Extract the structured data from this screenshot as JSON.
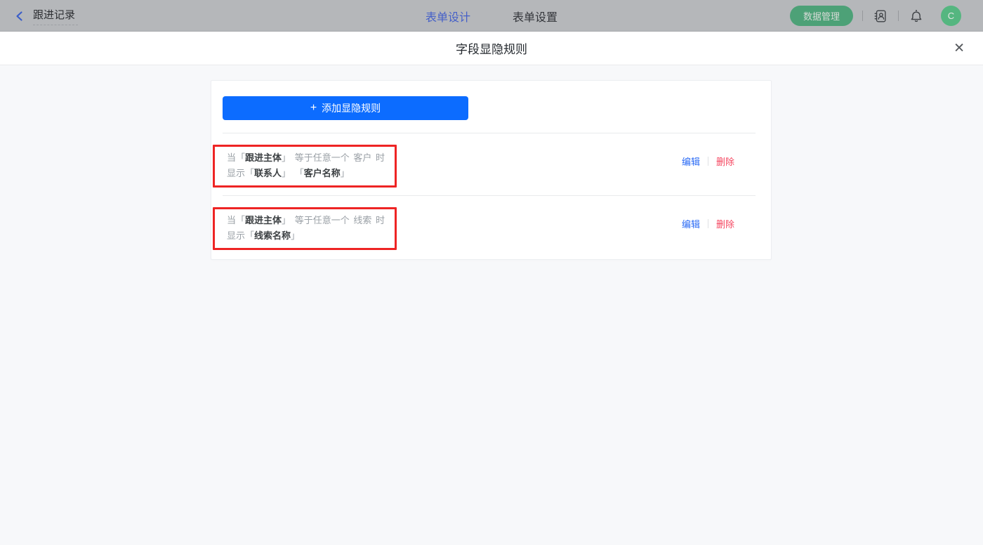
{
  "topbar": {
    "back_label": "跟进记录",
    "tabs": [
      {
        "label": "表单设计",
        "active": true
      },
      {
        "label": "表单设置",
        "active": false
      }
    ],
    "data_manage_button": "数据管理",
    "avatar_letter": "C"
  },
  "modal": {
    "title": "字段显隐规则",
    "close_glyph": "✕"
  },
  "panel": {
    "add_button_plus": "+",
    "add_button_label": "添加显隐规则",
    "bracket_open": "「",
    "bracket_close": "」",
    "rules": [
      {
        "when": "当",
        "field": "跟进主体",
        "operator": "等于任意一个",
        "value": "客户",
        "suffix": "时",
        "show": "显示",
        "show_fields": [
          "联系人",
          "客户名称"
        ],
        "edit_label": "编辑",
        "delete_label": "删除"
      },
      {
        "when": "当",
        "field": "跟进主体",
        "operator": "等于任意一个",
        "value": "线索",
        "suffix": "时",
        "show": "显示",
        "show_fields": [
          "线索名称"
        ],
        "edit_label": "编辑",
        "delete_label": "删除"
      }
    ]
  },
  "colors": {
    "accent_blue": "#0c6cff",
    "annotation_red": "#ee2424",
    "link_blue": "#2a6af5",
    "link_red": "#f5455f",
    "brand_green": "#4da177",
    "topbar_dimmed_bg": "#b5b7ba"
  }
}
